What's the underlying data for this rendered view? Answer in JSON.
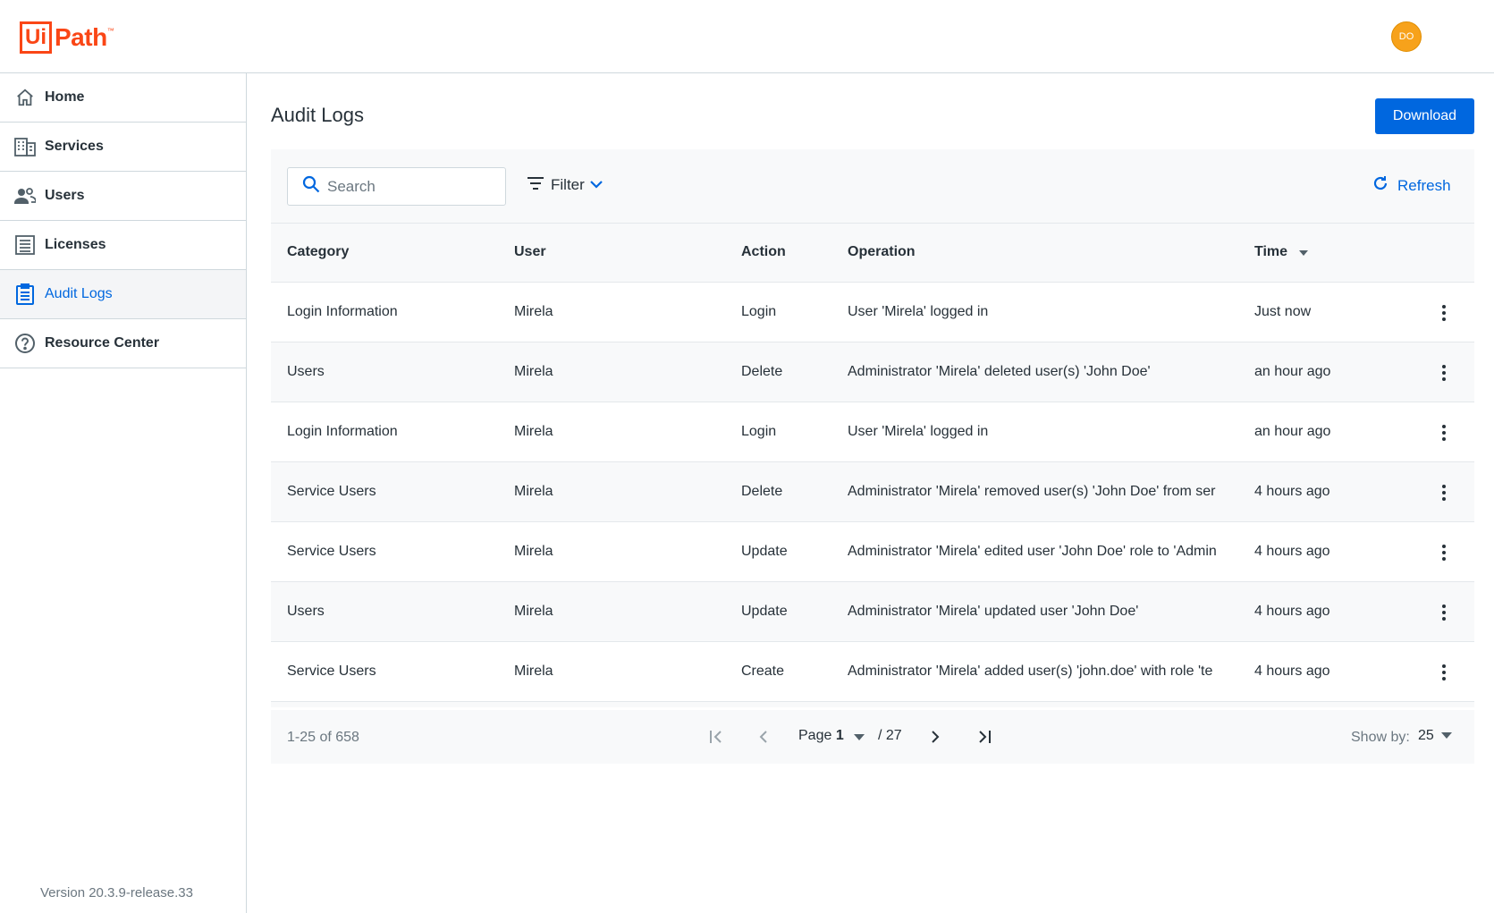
{
  "header": {
    "logo_box": "Ui",
    "logo_text": "Path",
    "logo_tm": "™",
    "avatar_initials": "DO"
  },
  "sidebar": {
    "items": [
      {
        "label": "Home",
        "icon": "home-icon"
      },
      {
        "label": "Services",
        "icon": "building-icon"
      },
      {
        "label": "Users",
        "icon": "users-icon"
      },
      {
        "label": "Licenses",
        "icon": "list-icon"
      },
      {
        "label": "Audit Logs",
        "icon": "clipboard-icon",
        "active": true
      },
      {
        "label": "Resource Center",
        "icon": "help-circle-icon"
      }
    ],
    "version": "Version 20.3.9-release.33"
  },
  "main": {
    "title": "Audit Logs",
    "download_label": "Download",
    "search_placeholder": "Search",
    "filter_label": "Filter",
    "refresh_label": "Refresh"
  },
  "table": {
    "columns": {
      "category": "Category",
      "user": "User",
      "action": "Action",
      "operation": "Operation",
      "time": "Time"
    },
    "rows": [
      {
        "category": "Login Information",
        "user": "Mirela",
        "action": "Login",
        "operation": "User 'Mirela' logged in",
        "time": "Just now"
      },
      {
        "category": "Users",
        "user": "Mirela",
        "action": "Delete",
        "operation": "Administrator 'Mirela' deleted user(s) 'John Doe'",
        "time": "an hour ago"
      },
      {
        "category": "Login Information",
        "user": "Mirela",
        "action": "Login",
        "operation": "User 'Mirela' logged in",
        "time": "an hour ago"
      },
      {
        "category": "Service Users",
        "user": "Mirela",
        "action": "Delete",
        "operation": "Administrator 'Mirela' removed user(s) 'John Doe' from ser",
        "time": "4 hours ago"
      },
      {
        "category": "Service Users",
        "user": "Mirela",
        "action": "Update",
        "operation": "Administrator 'Mirela' edited user 'John Doe' role to 'Admin",
        "time": "4 hours ago"
      },
      {
        "category": "Users",
        "user": "Mirela",
        "action": "Update",
        "operation": "Administrator 'Mirela' updated user 'John Doe'",
        "time": "4 hours ago"
      },
      {
        "category": "Service Users",
        "user": "Mirela",
        "action": "Create",
        "operation": "Administrator 'Mirela' added user(s) 'john.doe' with role 'te",
        "time": "4 hours ago"
      }
    ]
  },
  "pagination": {
    "range": "1-25 of 658",
    "page_prefix": "Page",
    "page_current": "1",
    "page_total": "/ 27",
    "show_by_label": "Show by:",
    "show_by_value": "25"
  },
  "colors": {
    "brand": "#fa4616",
    "accent": "#0067df",
    "avatar": "#f7a21b"
  }
}
